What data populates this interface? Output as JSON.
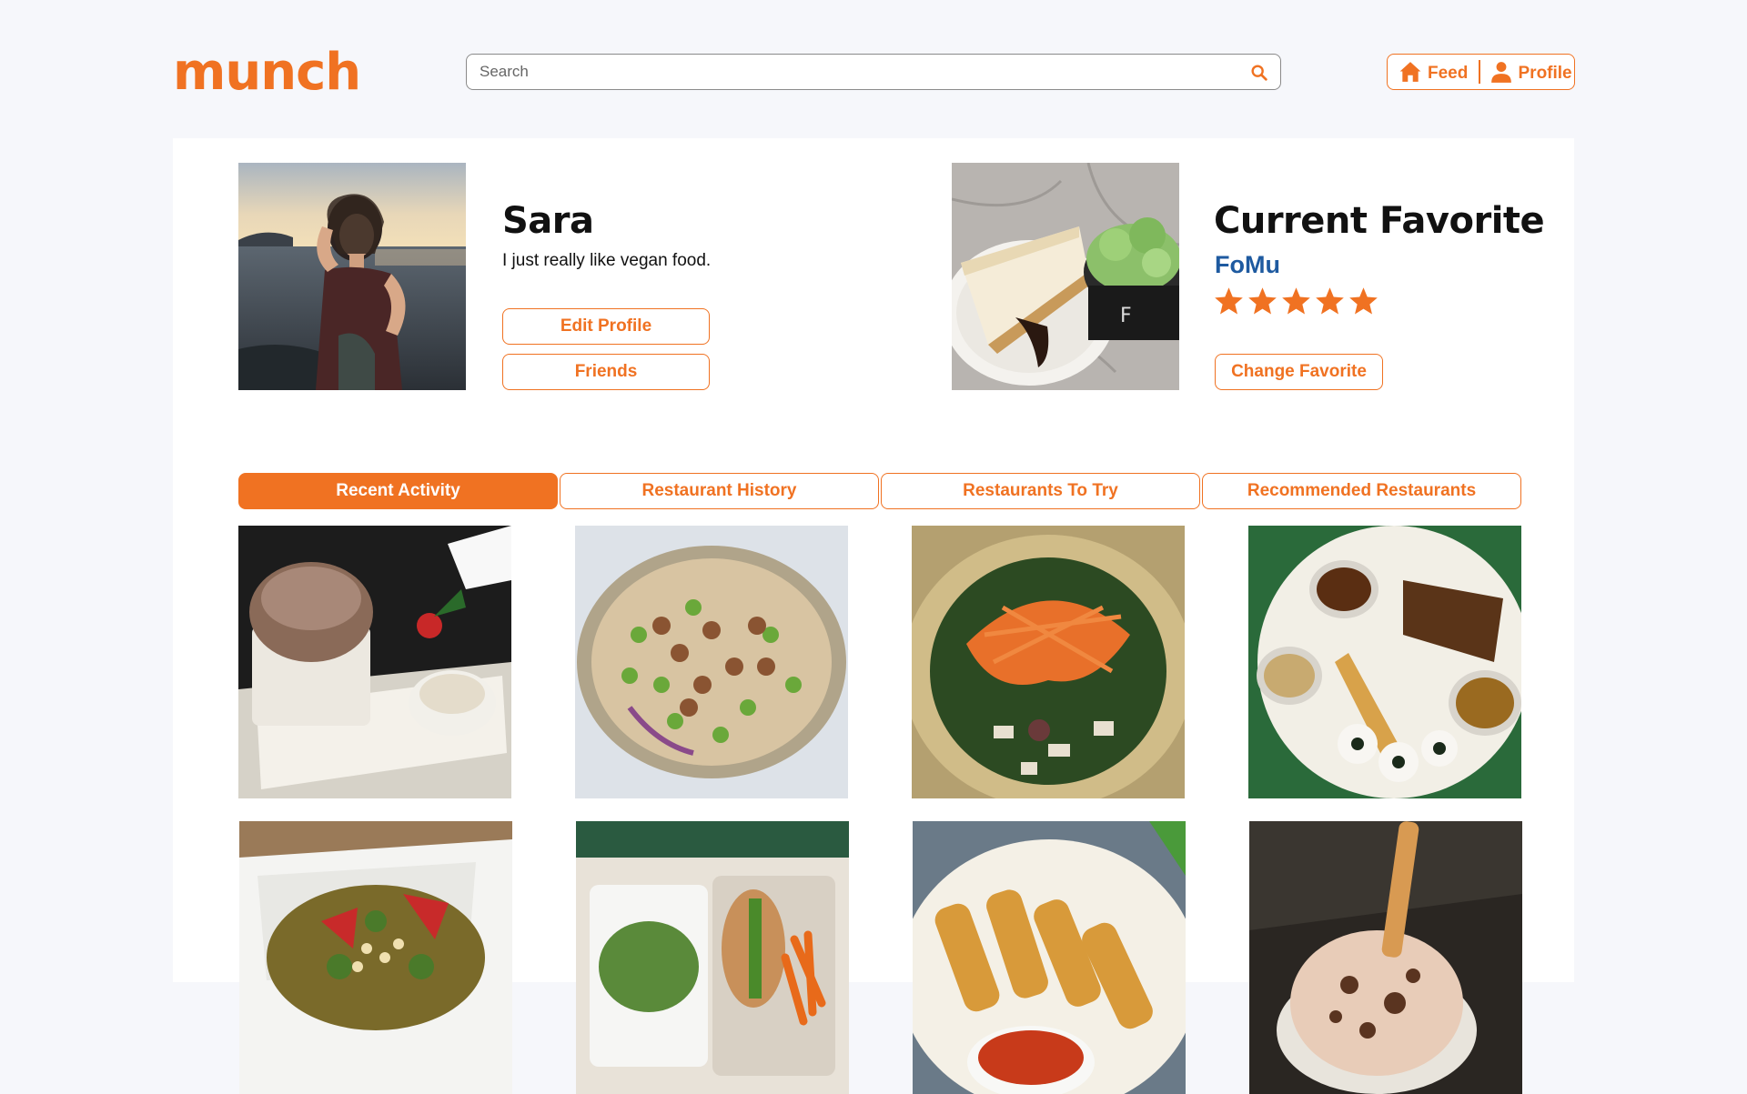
{
  "header": {
    "logo": "munch",
    "search": {
      "placeholder": "Search",
      "value": ""
    },
    "nav": [
      {
        "label": "Feed",
        "icon": "home-icon"
      },
      {
        "label": "Profile",
        "icon": "person-icon"
      }
    ]
  },
  "profile": {
    "name": "Sara",
    "bio": "I just really like vegan food.",
    "edit_label": "Edit Profile",
    "friends_label": "Friends"
  },
  "favorite": {
    "title": "Current Favorite",
    "restaurant": "FoMu",
    "rating": 5,
    "max_rating": 5,
    "change_label": "Change Favorite"
  },
  "tabs": [
    {
      "label": "Recent Activity",
      "active": true
    },
    {
      "label": "Restaurant History",
      "active": false
    },
    {
      "label": "Restaurants To Try",
      "active": false
    },
    {
      "label": "Recommended Restaurants",
      "active": false
    }
  ],
  "theme": {
    "accent": "#f07222",
    "link": "#1e5aa0",
    "background": "#f6f7fb"
  }
}
